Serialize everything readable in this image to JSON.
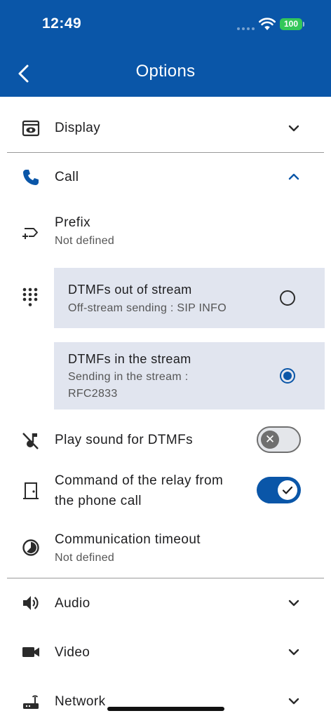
{
  "status_bar": {
    "time": "12:49",
    "battery": "100"
  },
  "header": {
    "title": "Options"
  },
  "sections": {
    "display": {
      "label": "Display"
    },
    "call": {
      "label": "Call"
    },
    "audio": {
      "label": "Audio"
    },
    "video": {
      "label": "Video"
    },
    "network": {
      "label": "Network"
    }
  },
  "call": {
    "prefix": {
      "label": "Prefix",
      "value": "Not defined"
    },
    "dtmf_out": {
      "title": "DTMFs out of stream",
      "subtitle": "Off-stream sending : SIP INFO",
      "selected": false
    },
    "dtmf_in": {
      "title": "DTMFs in the stream",
      "subtitle": "Sending in the stream : RFC2833",
      "selected": true
    },
    "play_sound": {
      "label": "Play sound for DTMFs",
      "enabled": false
    },
    "relay": {
      "label_line1": "Command of the relay from",
      "label_line2": "the phone call",
      "enabled": true
    },
    "timeout": {
      "label": "Communication timeout",
      "value": "Not defined"
    }
  },
  "colors": {
    "primary": "#0a56a8",
    "card_bg": "#e1e5ef",
    "battery": "#33c759"
  },
  "icons": {
    "display": "eye-window-icon",
    "call": "phone-icon",
    "prefix": "prefix-tag-icon",
    "dtmf": "dialpad-icon",
    "play_sound": "music-off-icon",
    "relay": "door-icon",
    "timeout": "timer-icon",
    "audio": "speaker-icon",
    "video": "video-camera-icon",
    "network": "router-icon"
  }
}
